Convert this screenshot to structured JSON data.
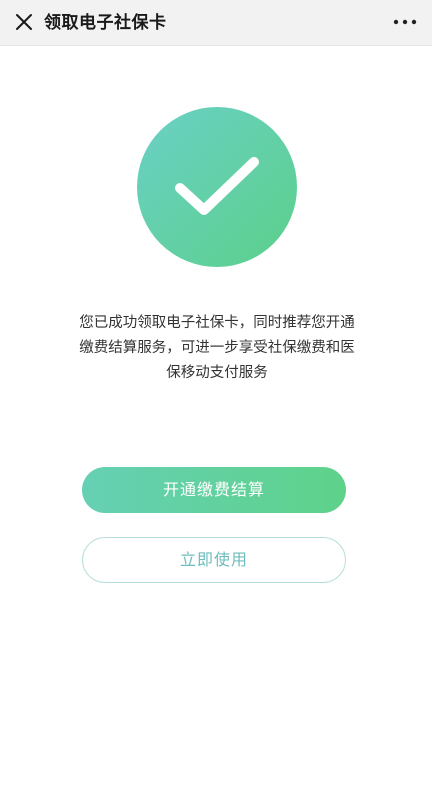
{
  "header": {
    "title": "领取电子社保卡"
  },
  "result": {
    "message": "您已成功领取电子社保卡，同时推荐您开通缴费结算服务，可进一步享受社保缴费和医保移动支付服务"
  },
  "actions": {
    "primary_label": "开通缴费结算",
    "secondary_label": "立即使用"
  },
  "icons": {
    "close": "close-icon",
    "more": "more-icon",
    "success": "check-icon"
  },
  "colors": {
    "accent_start": "#6ad0c6",
    "accent_end": "#5cd08a",
    "outline": "#b9dfdc",
    "secondary_text": "#6fbcbc"
  }
}
